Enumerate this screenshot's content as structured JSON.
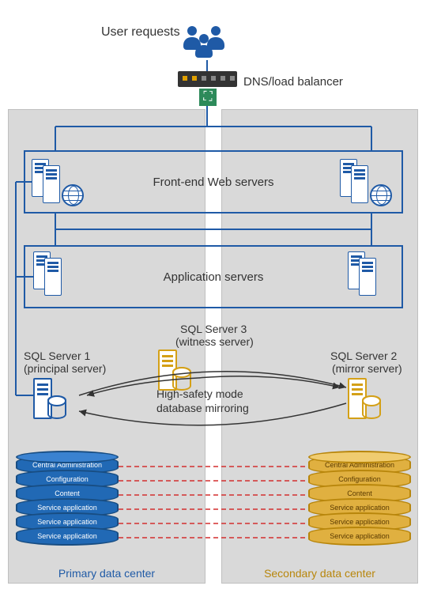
{
  "header": {
    "user_requests": "User requests",
    "dns_label": "DNS/load balancer"
  },
  "tiers": {
    "web": "Front-end Web servers",
    "app": "Application servers"
  },
  "sql": {
    "s1_name": "SQL Server 1",
    "s1_role": "(principal server)",
    "s2_name": "SQL Server 2",
    "s2_role": "(mirror server)",
    "s3_name": "SQL Server 3",
    "s3_role": "(witness server)",
    "mirroring_l1": "High-safety mode",
    "mirroring_l2": "database mirroring"
  },
  "databases": [
    "Central Administration",
    "Configuration",
    "Content",
    "Service application",
    "Service application",
    "Service application"
  ],
  "datacenters": {
    "primary": "Primary data center",
    "secondary": "Secondary data center"
  },
  "icons": {
    "users": "users-icon",
    "switch": "network-switch-icon",
    "expand": "expand-arrows-icon",
    "server": "server-tower-icon",
    "globe": "globe-icon",
    "database": "database-cylinder-icon"
  }
}
